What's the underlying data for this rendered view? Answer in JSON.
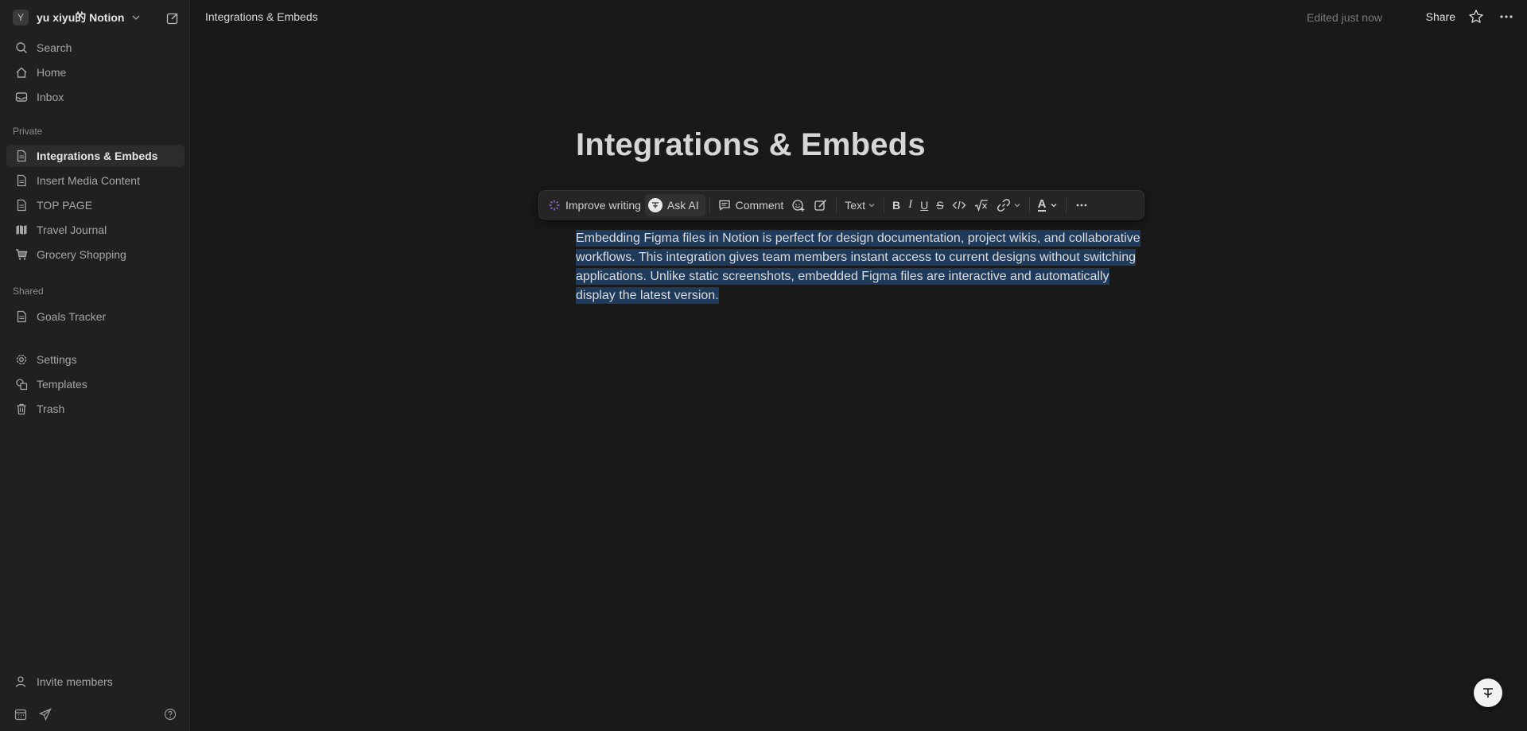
{
  "workspace": {
    "avatar_letter": "Y",
    "name": "yu xiyu的 Notion"
  },
  "sidebar": {
    "top_items": [
      {
        "label": "Search",
        "icon": "search-icon"
      },
      {
        "label": "Home",
        "icon": "home-icon"
      },
      {
        "label": "Inbox",
        "icon": "inbox-icon"
      }
    ],
    "private_label": "Private",
    "private_items": [
      {
        "label": "Integrations & Embeds",
        "icon": "page-icon",
        "active": true
      },
      {
        "label": "Insert Media Content",
        "icon": "page-icon"
      },
      {
        "label": "TOP PAGE",
        "icon": "page-icon"
      },
      {
        "label": "Travel Journal",
        "icon": "map-icon"
      },
      {
        "label": "Grocery Shopping",
        "icon": "cart-icon"
      }
    ],
    "shared_label": "Shared",
    "shared_items": [
      {
        "label": "Goals Tracker",
        "icon": "page-icon"
      }
    ],
    "utility_items": [
      {
        "label": "Settings",
        "icon": "gear-icon"
      },
      {
        "label": "Templates",
        "icon": "templates-icon"
      },
      {
        "label": "Trash",
        "icon": "trash-icon"
      }
    ],
    "invite_label": "Invite members"
  },
  "topbar": {
    "breadcrumb": "Integrations & Embeds",
    "edited": "Edited just now",
    "share": "Share"
  },
  "page": {
    "title": "Integrations & Embeds",
    "body": "Embedding Figma files in Notion is perfect for design documentation, project wikis, and collaborative workflows. This integration gives team members instant access to current designs without switching applications. Unlike static screenshots, embedded Figma files are interactive and automatically display the latest version."
  },
  "toolbar": {
    "improve_writing": "Improve writing",
    "ask_ai": "Ask AI",
    "comment": "Comment",
    "text_type": "Text"
  },
  "colors": {
    "background": "#191919",
    "sidebar": "#202020",
    "selection": "#1f3a5a",
    "accent_ai": "#9b6fe0"
  }
}
